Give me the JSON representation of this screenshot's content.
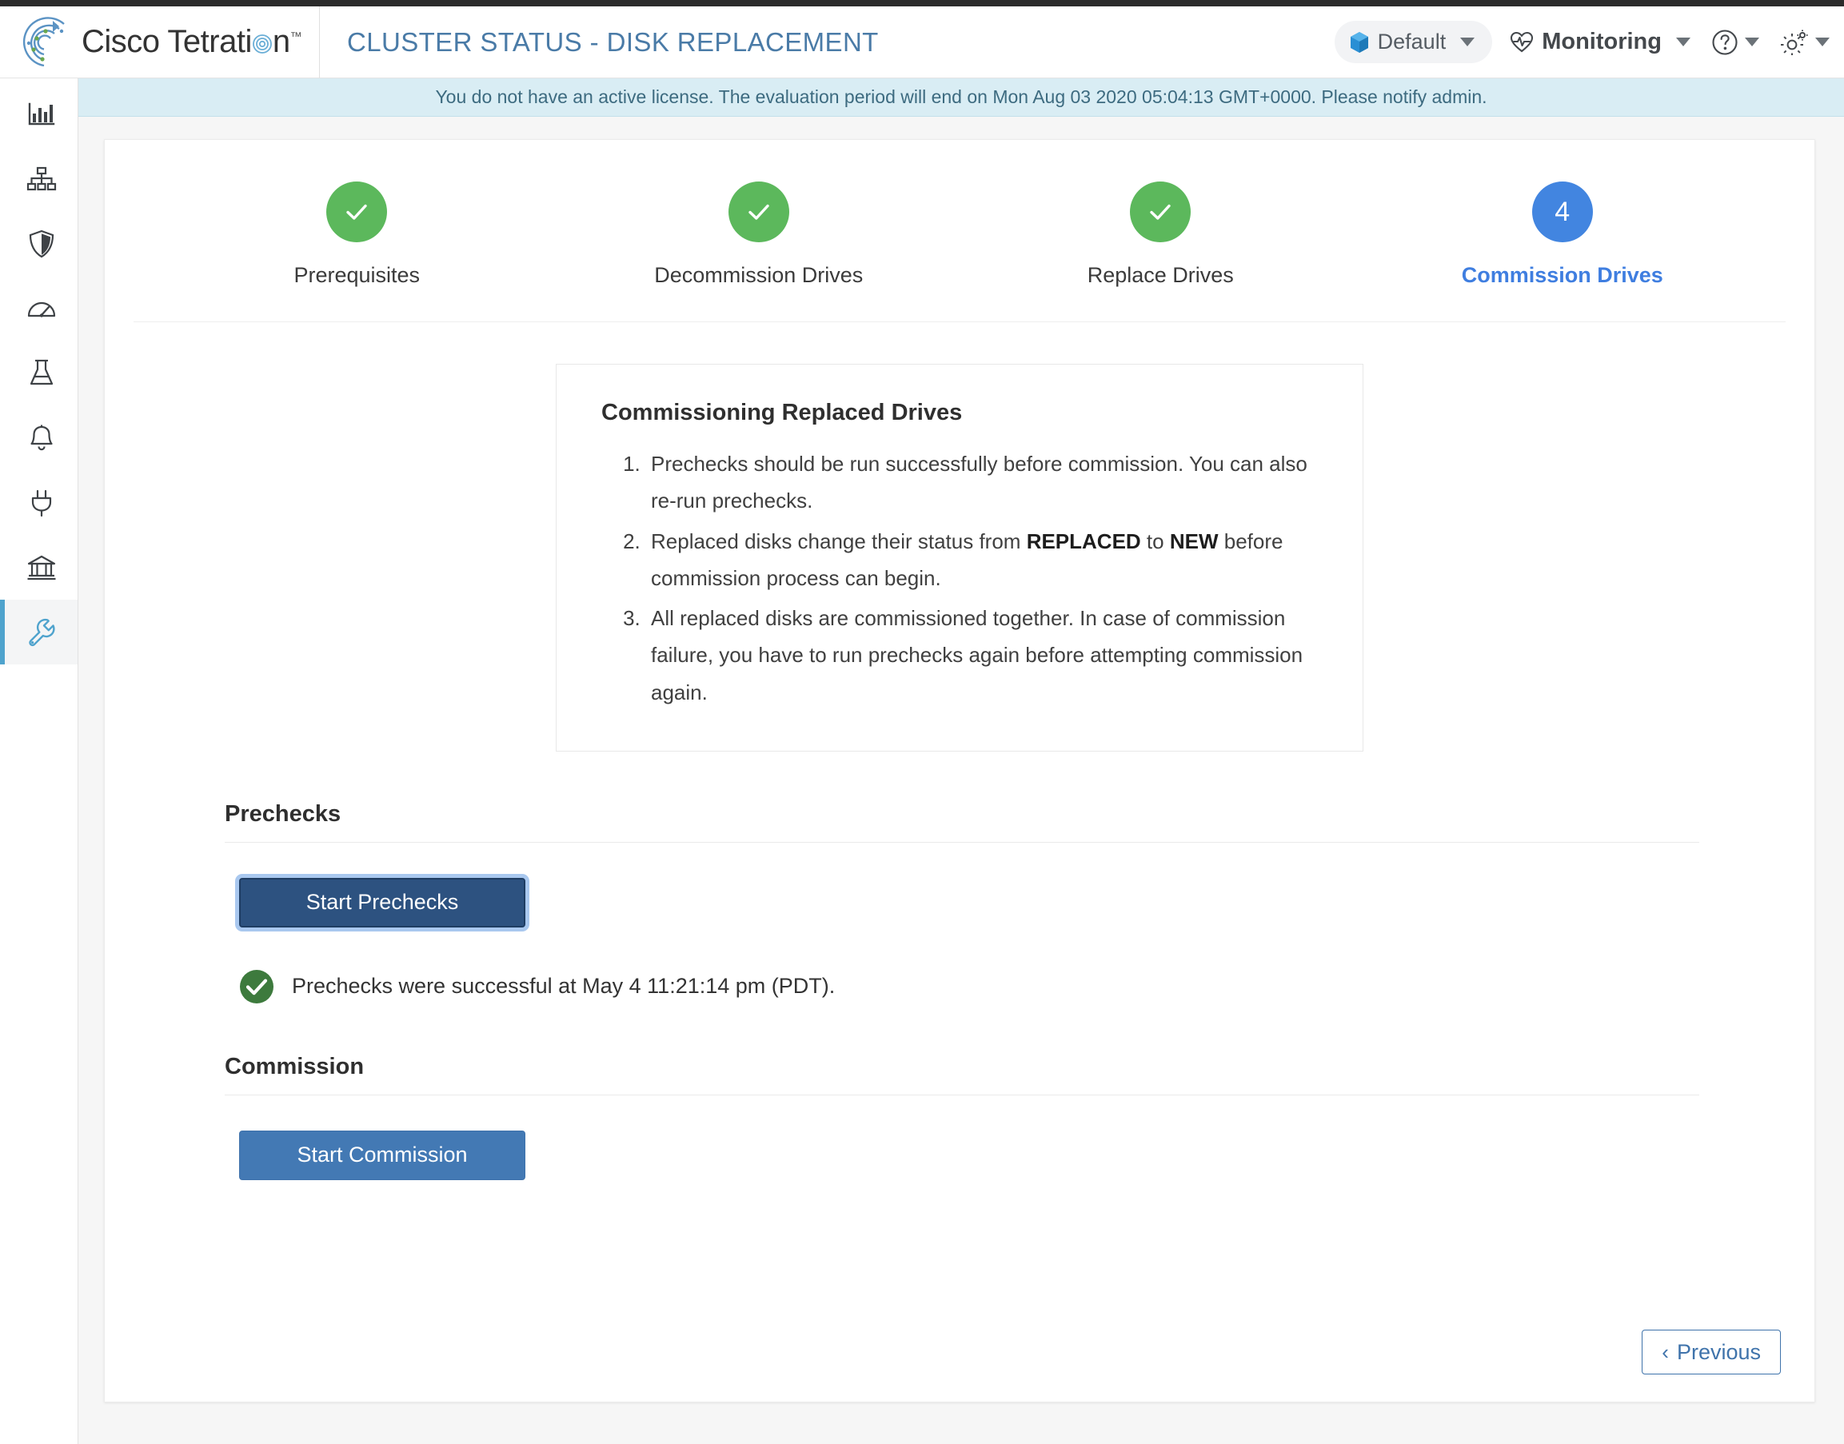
{
  "brand": {
    "name_part1": "Cisco Tetrati",
    "name_part2": "n",
    "trademark": "™",
    "logo_icon": "tetration-spiral-logo"
  },
  "header": {
    "page_title": "CLUSTER STATUS - DISK REPLACEMENT",
    "scope_selector": {
      "label": "Default",
      "icon": "cube-icon"
    },
    "monitoring_menu": {
      "label": "Monitoring",
      "icon": "heartbeat-icon"
    },
    "help_menu": {
      "icon": "question-circle-icon"
    },
    "settings_menu": {
      "icon": "gear-icon"
    }
  },
  "banner": {
    "text": "You do not have an active license. The evaluation period will end on Mon Aug 03 2020 05:04:13 GMT+0000.   Please notify admin."
  },
  "sidebar": {
    "items": [
      {
        "name": "dashboard",
        "icon": "bar-chart-icon",
        "active": false
      },
      {
        "name": "application-topology",
        "icon": "sitemap-icon",
        "active": false
      },
      {
        "name": "security",
        "icon": "shield-icon",
        "active": false
      },
      {
        "name": "performance",
        "icon": "gauge-icon",
        "active": false
      },
      {
        "name": "lab",
        "icon": "flask-icon",
        "active": false
      },
      {
        "name": "alerts",
        "icon": "bell-icon",
        "active": false
      },
      {
        "name": "connectors",
        "icon": "plug-icon",
        "active": false
      },
      {
        "name": "platform",
        "icon": "bank-icon",
        "active": false
      },
      {
        "name": "maintenance",
        "icon": "wrench-icon",
        "active": true
      }
    ]
  },
  "stepper": {
    "steps": [
      {
        "label": "Prerequisites",
        "state": "done",
        "number": 1,
        "badge": "✓"
      },
      {
        "label": "Decommission Drives",
        "state": "done",
        "number": 2,
        "badge": "✓"
      },
      {
        "label": "Replace Drives",
        "state": "done",
        "number": 3,
        "badge": "✓"
      },
      {
        "label": "Commission Drives",
        "state": "current",
        "number": 4,
        "badge": "4"
      }
    ]
  },
  "info_box": {
    "title": "Commissioning Replaced Drives",
    "items": [
      {
        "pre": "Prechecks should be run successfully before commission. You can also re-run prechecks.",
        "bold1": "",
        "mid": "",
        "bold2": "",
        "post": ""
      },
      {
        "pre": "Replaced disks change their status from ",
        "bold1": "REPLACED",
        "mid": " to ",
        "bold2": "NEW",
        "post": " before commission process can begin."
      },
      {
        "pre": "All replaced disks are commissioned together. In case of commission failure, you have to run prechecks again before attempting commission again.",
        "bold1": "",
        "mid": "",
        "bold2": "",
        "post": ""
      }
    ]
  },
  "prechecks_section": {
    "title": "Prechecks",
    "button_label": "Start Prechecks",
    "status_text": "Prechecks were successful at May 4 11:21:14 pm (PDT).",
    "status_icon": "check-circle-icon"
  },
  "commission_section": {
    "title": "Commission",
    "button_label": "Start Commission"
  },
  "footer": {
    "previous_label": "Previous",
    "previous_chevron": "‹"
  },
  "colors": {
    "step_done": "#5cb85c",
    "step_current": "#4285e0",
    "title_blue": "#4a7ba7",
    "banner_bg": "#d9edf4",
    "btn_prechecks": "#2d5280",
    "btn_commission": "#4379b4",
    "sidebar_active": "#4fa3cd",
    "success_green": "#3d7a3d"
  }
}
